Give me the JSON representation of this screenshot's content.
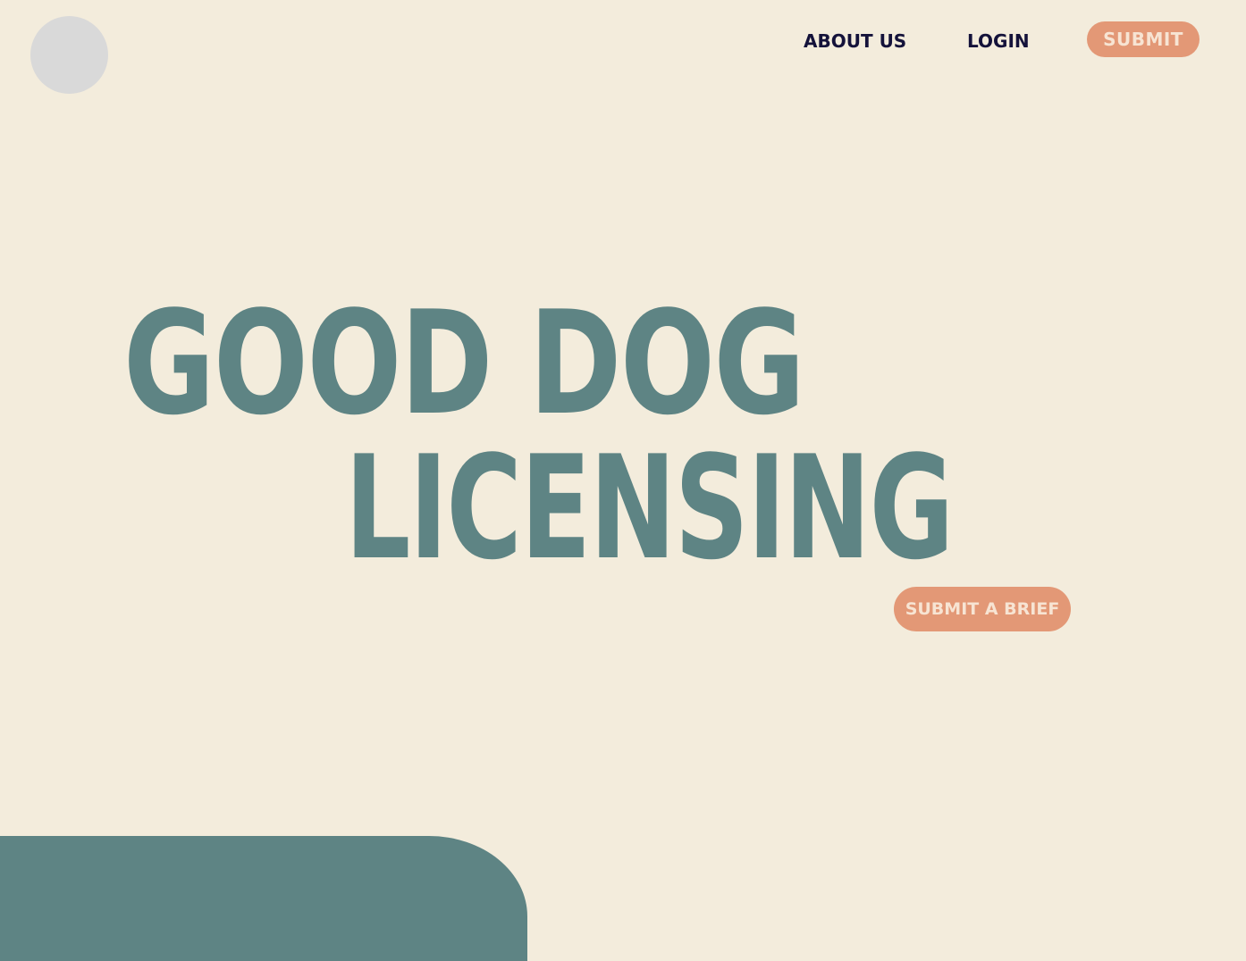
{
  "nav": {
    "about_label": "ABOUT US",
    "login_label": "LOGIN",
    "submit_label": "SUBMIT"
  },
  "hero": {
    "line1": "GOOD DOG",
    "line2": "LICENSING",
    "cta_label": "SUBMIT A BRIEF"
  },
  "colors": {
    "background": "#f3ecdc",
    "teal": "#5e8484",
    "accent": "#e39876",
    "nav_text": "#14123a",
    "placeholder": "#d9d9d9"
  }
}
